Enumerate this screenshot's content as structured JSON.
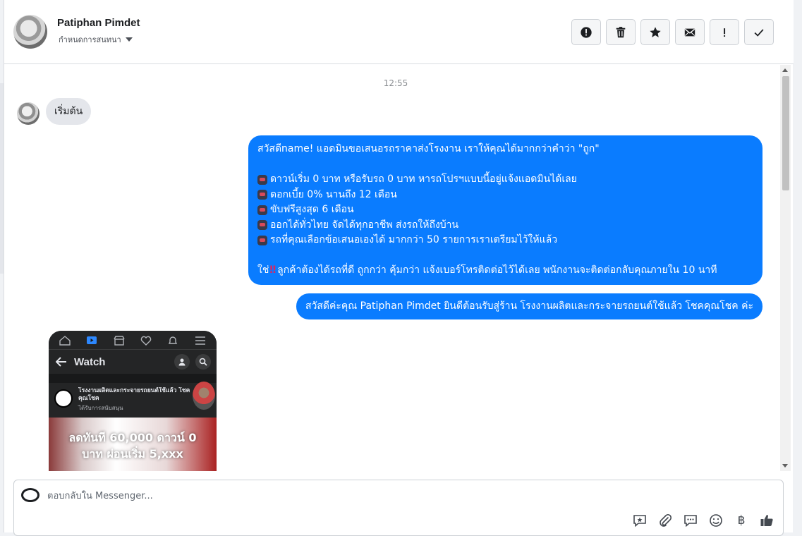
{
  "header": {
    "name": "Patiphan Pimdet",
    "subtitle": "กำหนดการสนทนา",
    "actions": [
      "spam-icon",
      "trash-icon",
      "star-icon",
      "mail-icon",
      "important-icon",
      "check-icon"
    ]
  },
  "conversation": {
    "timestamp": "12:55",
    "incoming": {
      "text": "เริ่มต้น"
    },
    "outgoing1": {
      "line1": "สวัสดีname! แอดมินขอเสนอรถราคาส่งโรงงาน เราให้คุณได้มากกว่าคำว่า \"ถูก\"",
      "bullets": [
        "ดาวน์เริ่ม 0 บาท หรือรับรถ 0 บาท หารถโปรฯแบบนี้อยู่แจ้งแอดมินได้เลย",
        "ดอกเบี้ย 0% นานถึง 12 เดือน",
        "ขับฟรีสูงสุด 6 เดือน",
        "ออกได้ทั่วไทย จัดได้ทุกอาชีพ ส่งรถให้ถึงบ้าน",
        "รถที่คุณเลือกข้อเสนอเองได้ มากกว่า 50 รายการเราเตรียมไว้ให้แล้ว"
      ],
      "closing_prefix": "ใช่",
      "closing_emoji": "!!",
      "closing": "ลูกค้าต้องได้รถที่ดี ถูกกว่า คุ้มกว่า แจ้งเบอร์โทรติดต่อไว้ได้เลย พนักงานจะติดต่อกลับคุณภายใน 10 นาที"
    },
    "outgoing2": {
      "text": "สวัสดีค่ะคุณ Patiphan Pimdet ยินดีต้อนรับสู่ร้าน โรงงานผลิตและกระจายรถยนต์ใช้แล้ว โชคคุณโชค ค่ะ"
    },
    "video_preview": {
      "title": "Watch",
      "page_name_line1": "โรงงานผลิตและกระจายรถยนต์ใช้แล้ว โชค",
      "page_name_line2": "คุณโชค",
      "sponsored": "ได้รับการสนับสนุน",
      "banner_line1": "ลดทันที 60,000 ดาวน์ 0",
      "banner_line2": "บาท ผ่อนเริ่ม 5,xxx"
    }
  },
  "composer": {
    "placeholder": "ตอบกลับใน Messenger...",
    "baht_symbol": "฿",
    "tools": [
      "saved-reply-icon",
      "attach-icon",
      "quick-reply-icon",
      "emoji-icon",
      "baht-icon",
      "like-icon"
    ]
  },
  "colors": {
    "outgoing_bubble": "#0a7cff",
    "incoming_bubble": "#e4e6eb"
  }
}
